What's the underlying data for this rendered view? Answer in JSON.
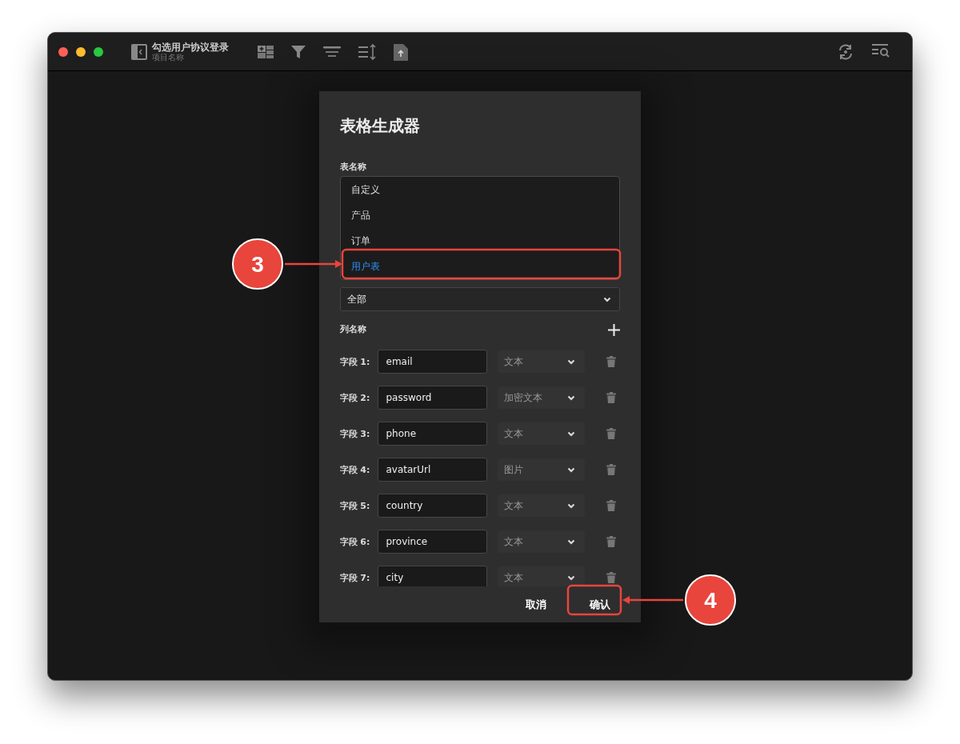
{
  "window": {
    "title": "勾选用户协议登录",
    "subtitle": "项目名称"
  },
  "dialog": {
    "title": "表格生成器",
    "table_name_label": "表名称",
    "table_options": [
      {
        "label": "自定义",
        "selected": false
      },
      {
        "label": "产品",
        "selected": false
      },
      {
        "label": "订单",
        "selected": false
      },
      {
        "label": "用户表",
        "selected": true
      }
    ],
    "initial_data_select": {
      "value": "全部"
    },
    "columns_label": "列名称",
    "fields": [
      {
        "label": "字段 1:",
        "value": "email",
        "type": "文本"
      },
      {
        "label": "字段 2:",
        "value": "password",
        "type": "加密文本"
      },
      {
        "label": "字段 3:",
        "value": "phone",
        "type": "文本"
      },
      {
        "label": "字段 4:",
        "value": "avatarUrl",
        "type": "图片"
      },
      {
        "label": "字段 5:",
        "value": "country",
        "type": "文本"
      },
      {
        "label": "字段 6:",
        "value": "province",
        "type": "文本"
      },
      {
        "label": "字段 7:",
        "value": "city",
        "type": "文本"
      }
    ],
    "buttons": [
      "取消",
      "确认"
    ]
  },
  "annotations": [
    {
      "number": "3"
    },
    {
      "number": "4"
    }
  ]
}
